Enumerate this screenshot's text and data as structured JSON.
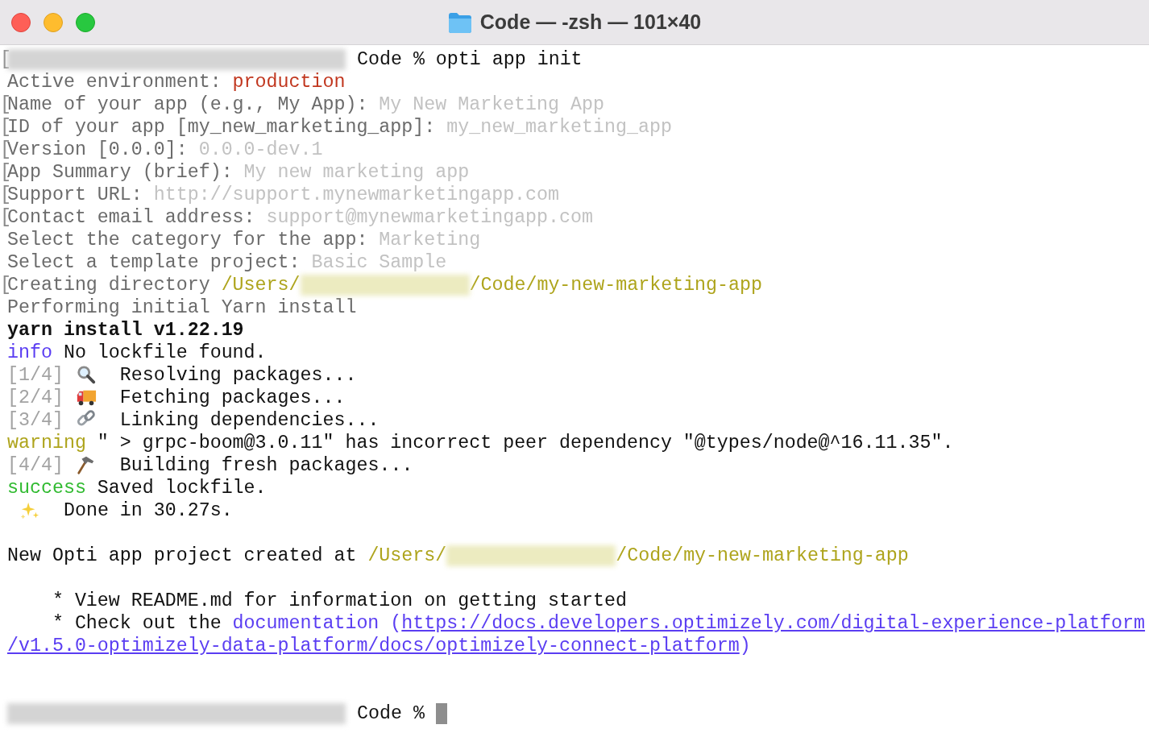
{
  "window": {
    "title": "Code — -zsh — 101×40"
  },
  "lines": [
    {
      "gutter": "[",
      "segments": [
        {
          "kind": "redacted_long"
        },
        {
          "kind": "plain",
          "text": " Code % opti app init"
        }
      ]
    },
    {
      "segments": [
        {
          "kind": "label",
          "text": "Active environment: "
        },
        {
          "kind": "red",
          "text": "production"
        }
      ]
    },
    {
      "gutter": "[",
      "segments": [
        {
          "kind": "label",
          "text": "Name of your app (e.g., My App): "
        },
        {
          "kind": "answer",
          "text": "My New Marketing App"
        }
      ]
    },
    {
      "gutter": "[",
      "segments": [
        {
          "kind": "label",
          "text": "ID of your app [my_new_marketing_app]: "
        },
        {
          "kind": "answer",
          "text": "my_new_marketing_app"
        }
      ]
    },
    {
      "gutter": "[",
      "segments": [
        {
          "kind": "label",
          "text": "Version [0.0.0]: "
        },
        {
          "kind": "answer",
          "text": "0.0.0-dev.1"
        }
      ]
    },
    {
      "gutter": "[",
      "segments": [
        {
          "kind": "label",
          "text": "App Summary (brief): "
        },
        {
          "kind": "answer",
          "text": "My new marketing app"
        }
      ]
    },
    {
      "gutter": "[",
      "segments": [
        {
          "kind": "label",
          "text": "Support URL: "
        },
        {
          "kind": "answer",
          "text": "http://support.mynewmarketingapp.com"
        }
      ]
    },
    {
      "gutter": "[",
      "segments": [
        {
          "kind": "label",
          "text": "Contact email address: "
        },
        {
          "kind": "answer",
          "text": "support@mynewmarketingapp.com"
        }
      ]
    },
    {
      "segments": [
        {
          "kind": "label",
          "text": "Select the category for the app: "
        },
        {
          "kind": "answer",
          "text": "Marketing"
        }
      ]
    },
    {
      "segments": [
        {
          "kind": "label",
          "text": "Select a template project: "
        },
        {
          "kind": "answer",
          "text": "Basic Sample"
        }
      ]
    },
    {
      "gutter": "[",
      "segments": [
        {
          "kind": "label",
          "text": "Creating directory "
        },
        {
          "kind": "path",
          "text": "/Users/"
        },
        {
          "kind": "redacted_short"
        },
        {
          "kind": "path",
          "text": "/Code/my-new-marketing-app"
        }
      ]
    },
    {
      "segments": [
        {
          "kind": "label",
          "text": "Performing initial Yarn install"
        }
      ]
    },
    {
      "segments": [
        {
          "kind": "bold",
          "text": "yarn install v1.22.19"
        }
      ]
    },
    {
      "segments": [
        {
          "kind": "info",
          "text": "info"
        },
        {
          "kind": "plain",
          "text": " No lockfile found."
        }
      ]
    },
    {
      "segments": [
        {
          "kind": "step",
          "text": "[1/4]"
        },
        {
          "kind": "icon"
        },
        {
          "kind": "plain",
          "text": "  Resolving packages..."
        }
      ]
    },
    {
      "segments": [
        {
          "kind": "step",
          "text": "[2/4]"
        },
        {
          "kind": "icon"
        },
        {
          "kind": "plain",
          "text": "  Fetching packages..."
        }
      ]
    },
    {
      "segments": [
        {
          "kind": "step",
          "text": "[3/4]"
        },
        {
          "kind": "icon"
        },
        {
          "kind": "plain",
          "text": "  Linking dependencies..."
        }
      ]
    },
    {
      "segments": [
        {
          "kind": "warning",
          "text": "warning"
        },
        {
          "kind": "plain",
          "text": " \" > grpc-boom@3.0.11\" has incorrect peer dependency \"@types/node@^16.11.35\"."
        }
      ]
    },
    {
      "segments": [
        {
          "kind": "step",
          "text": "[4/4]"
        },
        {
          "kind": "icon"
        },
        {
          "kind": "plain",
          "text": "  Building fresh packages..."
        }
      ]
    },
    {
      "segments": [
        {
          "kind": "success",
          "text": "success"
        },
        {
          "kind": "plain",
          "text": " Saved lockfile."
        }
      ]
    },
    {
      "segments": [
        {
          "kind": "icon"
        },
        {
          "kind": "plain",
          "text": "  Done in 30.27s."
        }
      ]
    },
    {
      "kind": "blank"
    },
    {
      "segments": [
        {
          "kind": "plain",
          "text": "New Opti app project created at "
        },
        {
          "kind": "path",
          "text": "/Users/"
        },
        {
          "kind": "redacted_short"
        },
        {
          "kind": "path",
          "text": "/Code/my-new-marketing-app"
        }
      ]
    },
    {
      "kind": "blank"
    },
    {
      "segments": [
        {
          "kind": "plain",
          "text": "    * View README.md for information on getting started"
        }
      ]
    },
    {
      "segments": [
        {
          "kind": "plain",
          "text": "    * Check out the "
        },
        {
          "kind": "info",
          "text": "documentation ("
        },
        {
          "kind": "link",
          "text": "https://docs.developers.optimizely.com/digital-experience-platform"
        }
      ]
    },
    {
      "segments": [
        {
          "kind": "link",
          "text": "/v1.5.0-optimizely-data-platform/docs/optimizely-connect-platform"
        },
        {
          "kind": "info",
          "text": ")"
        }
      ]
    },
    {
      "kind": "blank"
    },
    {
      "kind": "blank"
    },
    {
      "segments": [
        {
          "kind": "redacted_long"
        },
        {
          "kind": "plain",
          "text": " Code % "
        },
        {
          "kind": "cursor"
        }
      ]
    }
  ]
}
